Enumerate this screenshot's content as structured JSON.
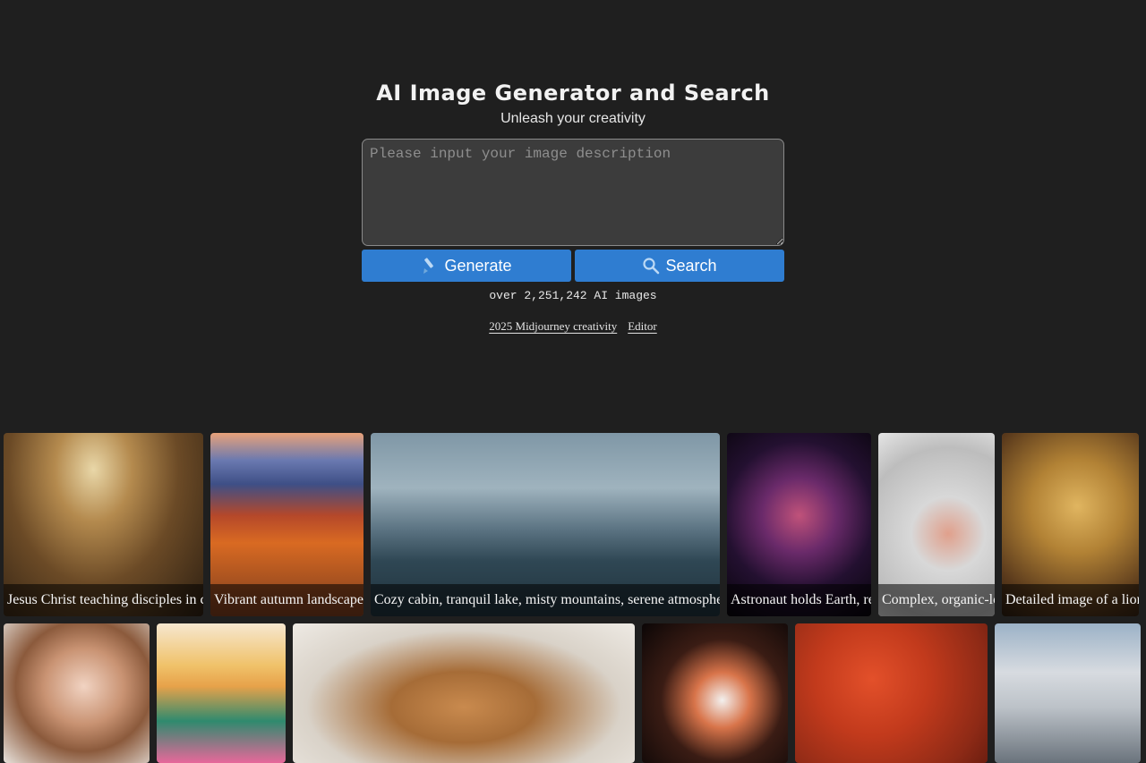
{
  "header": {
    "title": "AI Image Generator and Search",
    "subtitle": "Unleash your creativity"
  },
  "prompt": {
    "placeholder": "Please input your image description",
    "value": ""
  },
  "buttons": {
    "generate_label": "Generate",
    "generate_icon": "brush-icon",
    "search_label": "Search",
    "search_icon": "search-icon"
  },
  "stats": {
    "image_count_text": "over 2,251,242 AI images"
  },
  "links": [
    {
      "label": "2025 Midjourney creativity"
    },
    {
      "label": "Editor"
    }
  ],
  "colors": {
    "background": "#1f1f1f",
    "button": "#2f7dd1",
    "input_bg": "#3c3c3c"
  },
  "gallery": {
    "row1": [
      {
        "caption": "Jesus Christ teaching disciples in c"
      },
      {
        "caption": "Vibrant autumn landscape"
      },
      {
        "caption": "Cozy cabin, tranquil lake, misty mountains, serene atmosphe"
      },
      {
        "caption": "Astronaut holds Earth, re"
      },
      {
        "caption": "Complex, organic-lo"
      },
      {
        "caption": "Detailed image of a lion"
      }
    ]
  }
}
